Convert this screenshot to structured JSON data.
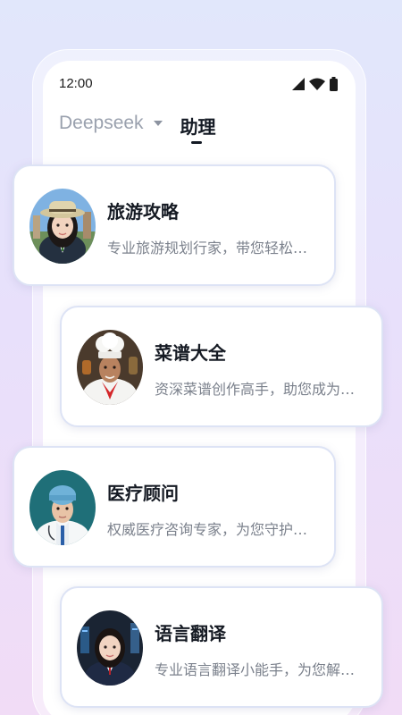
{
  "status_bar": {
    "time": "12:00",
    "icons": [
      "cellular-signal-icon",
      "wifi-icon",
      "battery-icon"
    ]
  },
  "tabs": {
    "model_label": "Deepseek",
    "model_caret_icon": "caret-down-icon",
    "assistant_label": "助理",
    "active_tab": "assistant"
  },
  "assistants": [
    {
      "name": "旅游攻略",
      "description": "专业旅游规划行家，带您轻松…",
      "avatar": "traveler-avatar"
    },
    {
      "name": "菜谱大全",
      "description": "资深菜谱创作高手，助您成为…",
      "avatar": "chef-avatar"
    },
    {
      "name": "医疗顾问",
      "description": "权威医疗咨询专家，为您守护…",
      "avatar": "doctor-avatar"
    },
    {
      "name": "语言翻译",
      "description": "专业语言翻译小能手，为您解…",
      "avatar": "translator-avatar"
    }
  ],
  "colors": {
    "background_top": "#e1e7fb",
    "background_bottom": "#f1dcf6",
    "card_border": "#dde3f5",
    "title_text": "#151a23",
    "description_text": "#7b818c",
    "inactive_tab_text": "#9aa1ae"
  }
}
